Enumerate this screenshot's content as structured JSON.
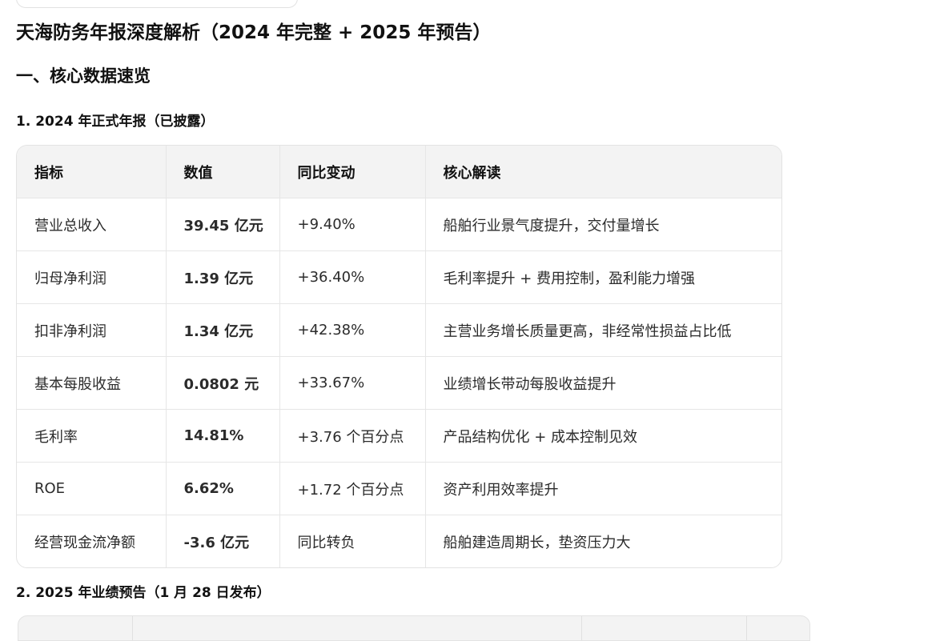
{
  "title": "天海防务年报深度解析（2024 年完整 + 2025 年预告）",
  "section_1": {
    "heading": "一、核心数据速览",
    "subsection_1": {
      "heading": "1. 2024 年正式年报（已披露）",
      "table": {
        "headers": [
          "指标",
          "数值",
          "同比变动",
          "核心解读"
        ],
        "rows": [
          [
            "营业总收入",
            "39.45 亿元",
            "+9.40%",
            "船舶行业景气度提升，交付量增长"
          ],
          [
            "归母净利润",
            "1.39 亿元",
            "+36.40%",
            "毛利率提升 + 费用控制，盈利能力增强"
          ],
          [
            "扣非净利润",
            "1.34 亿元",
            "+42.38%",
            "主营业务增长质量更高，非经常性损益占比低"
          ],
          [
            "基本每股收益",
            "0.0802 元",
            "+33.67%",
            "业绩增长带动每股收益提升"
          ],
          [
            "毛利率",
            "14.81%",
            "+3.76 个百分点",
            "产品结构优化 + 成本控制见效"
          ],
          [
            "ROE",
            "6.62%",
            "+1.72 个百分点",
            "资产利用效率提升"
          ],
          [
            "经营现金流净额",
            "-3.6 亿元",
            "同比转负",
            "船舶建造周期长，垫资压力大"
          ]
        ]
      }
    },
    "subsection_2": {
      "heading": "2. 2025 年业绩预告（1 月 28 日发布）"
    }
  }
}
